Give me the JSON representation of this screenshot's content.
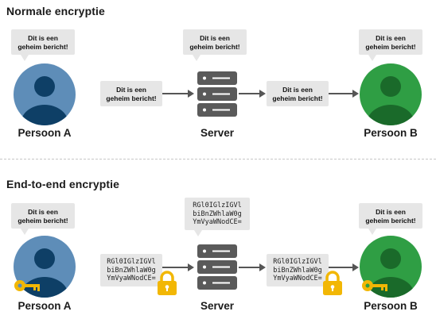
{
  "normal": {
    "title": "Normale encryptie",
    "plain_message": [
      "Dit is een",
      "geheim bericht!"
    ],
    "person_a": "Persoon A",
    "server": "Server",
    "person_b": "Persoon B"
  },
  "e2e": {
    "title": "End-to-end encryptie",
    "plain_message": [
      "Dit is een",
      "geheim bericht!"
    ],
    "cipher_message": [
      "RGl0IGlzIGVl",
      "biBnZWhlaW0g",
      "YmVyaWNodCE="
    ],
    "person_a": "Persoon A",
    "server": "Server",
    "person_b": "Persoon B"
  },
  "colors": {
    "person_a_bg": "#5e8db8",
    "person_a_fg": "#0e3f66",
    "person_b_bg": "#2f9e44",
    "person_b_fg": "#1a6a2a",
    "server": "#5a5a5a",
    "lock": "#f2b705",
    "key": "#f2b705",
    "bubble": "#e6e6e6"
  },
  "icons": {
    "avatar": "user-avatar-icon",
    "server": "server-icon",
    "lock": "padlock-icon",
    "key": "key-icon",
    "arrow": "arrow-right-icon"
  }
}
